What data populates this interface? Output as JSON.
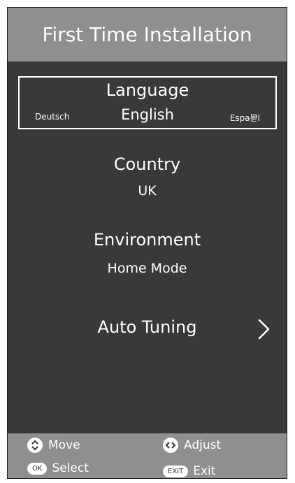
{
  "header": {
    "title": "First Time Installation"
  },
  "language": {
    "title": "Language",
    "selected": "English",
    "prev_option": "Deutsch",
    "next_option": "Espa뫋l"
  },
  "country": {
    "title": "Country",
    "value": "UK"
  },
  "environment": {
    "title": "Environment",
    "value": "Home Mode"
  },
  "auto_tuning": {
    "title": "Auto Tuning",
    "arrow_icon": "chevron-right-icon"
  },
  "footer": {
    "move": {
      "icon": "up-down-icon",
      "label": "Move"
    },
    "adjust": {
      "icon": "left-right-icon",
      "label": "Adjust"
    },
    "select": {
      "key": "OK",
      "label": "Select"
    },
    "exit": {
      "key": "EXIT",
      "label": "Exit"
    }
  },
  "colors": {
    "background": "#393939",
    "header_footer": "#8f8f8f",
    "text": "#ffffff"
  }
}
